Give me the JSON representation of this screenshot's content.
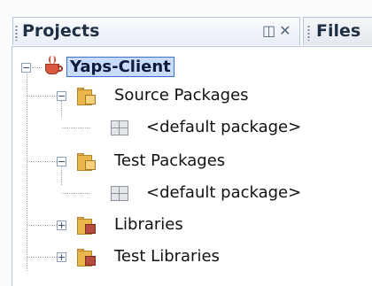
{
  "tabs": {
    "projects_label": "Projects",
    "files_label": "Files",
    "minimize_icon": "minimize-icon",
    "close_icon": "close-icon"
  },
  "tree": {
    "root": {
      "label": "Yaps-Client",
      "icon": "project-icon",
      "expanded": true
    },
    "items": [
      {
        "label": "Source Packages",
        "icon": "folder-icon",
        "expanded": true,
        "level": 1
      },
      {
        "label": "<default package>",
        "icon": "package-icon",
        "level": 2
      },
      {
        "label": "Test Packages",
        "icon": "folder-icon",
        "expanded": true,
        "level": 1
      },
      {
        "label": "<default package>",
        "icon": "package-icon",
        "level": 2
      },
      {
        "label": "Libraries",
        "icon": "library-folder-icon",
        "expanded": false,
        "level": 1
      },
      {
        "label": "Test Libraries",
        "icon": "library-folder-icon",
        "expanded": false,
        "level": 1
      }
    ]
  },
  "colors": {
    "selection_background": "#c9dcff",
    "selection_border": "#3d6fd9",
    "tab_border": "#b9c7dc"
  }
}
